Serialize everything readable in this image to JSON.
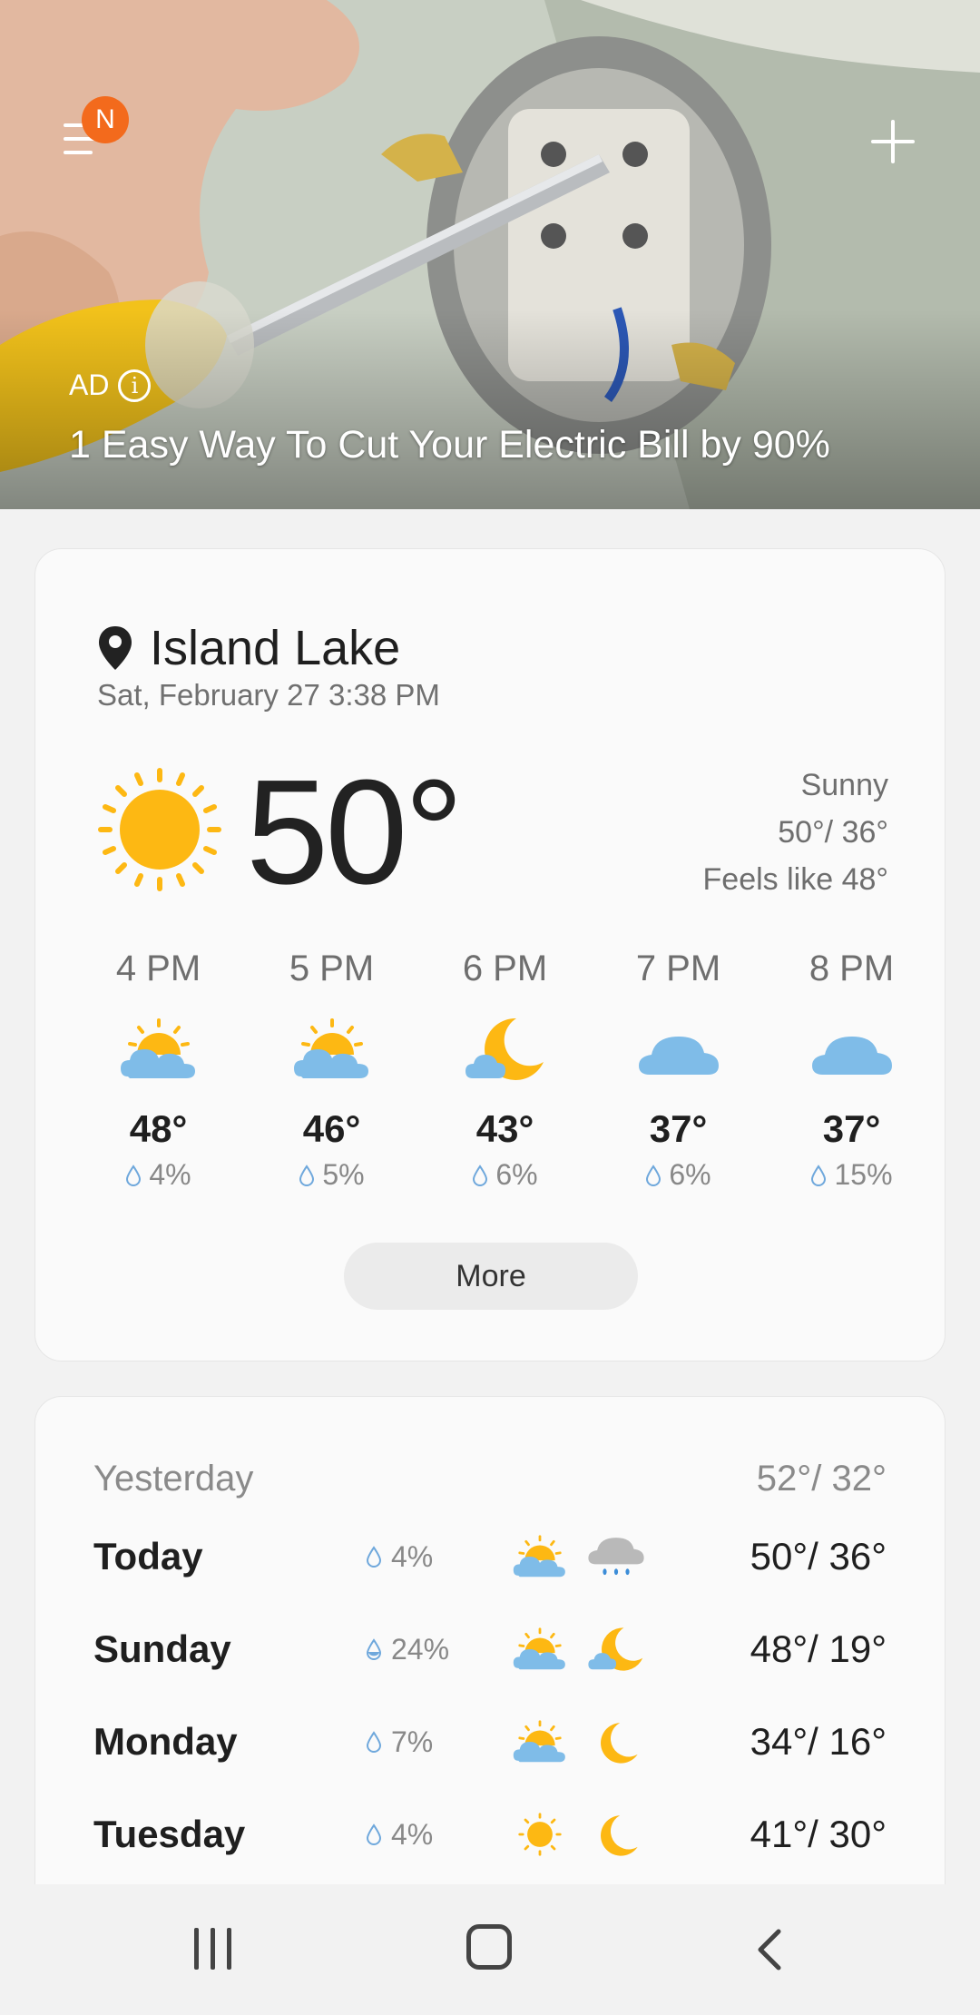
{
  "ad": {
    "badge": "N",
    "label": "AD",
    "headline": "1 Easy Way To Cut Your Electric Bill by 90%"
  },
  "current": {
    "location": "Island Lake",
    "datetime": "Sat, February 27 3:38 PM",
    "temperature": "50°",
    "condition": "Sunny",
    "high_low": "50°/ 36°",
    "feels_like": "Feels like 48°",
    "icon": "sun-icon"
  },
  "hourly": [
    {
      "time": "4 PM",
      "temp": "48°",
      "precip": "4%",
      "icon": "partly-sunny-icon"
    },
    {
      "time": "5 PM",
      "temp": "46°",
      "precip": "5%",
      "icon": "partly-sunny-icon"
    },
    {
      "time": "6 PM",
      "temp": "43°",
      "precip": "6%",
      "icon": "moon-cloud-icon"
    },
    {
      "time": "7 PM",
      "temp": "37°",
      "precip": "6%",
      "icon": "cloud-icon"
    },
    {
      "time": "8 PM",
      "temp": "37°",
      "precip": "15%",
      "icon": "cloud-icon"
    }
  ],
  "more_label": "More",
  "daily": {
    "yesterday": {
      "label": "Yesterday",
      "temps": "52°/ 32°"
    },
    "days": [
      {
        "name": "Today",
        "precip": "4%",
        "day_icon": "partly-sunny-icon",
        "night_icon": "rain-cloud-icon",
        "temps": "50°/ 36°"
      },
      {
        "name": "Sunday",
        "precip": "24%",
        "day_icon": "partly-sunny-icon",
        "night_icon": "moon-cloud-icon",
        "temps": "48°/ 19°"
      },
      {
        "name": "Monday",
        "precip": "7%",
        "day_icon": "partly-sunny-icon",
        "night_icon": "moon-icon",
        "temps": "34°/ 16°"
      },
      {
        "name": "Tuesday",
        "precip": "4%",
        "day_icon": "sun-icon",
        "night_icon": "moon-icon",
        "temps": "41°/ 30°"
      }
    ]
  },
  "colors": {
    "sun": "#FDB813",
    "cloud": "#7FBCE8",
    "drop": "#6FA8DC",
    "badge": "#F36A1C"
  }
}
